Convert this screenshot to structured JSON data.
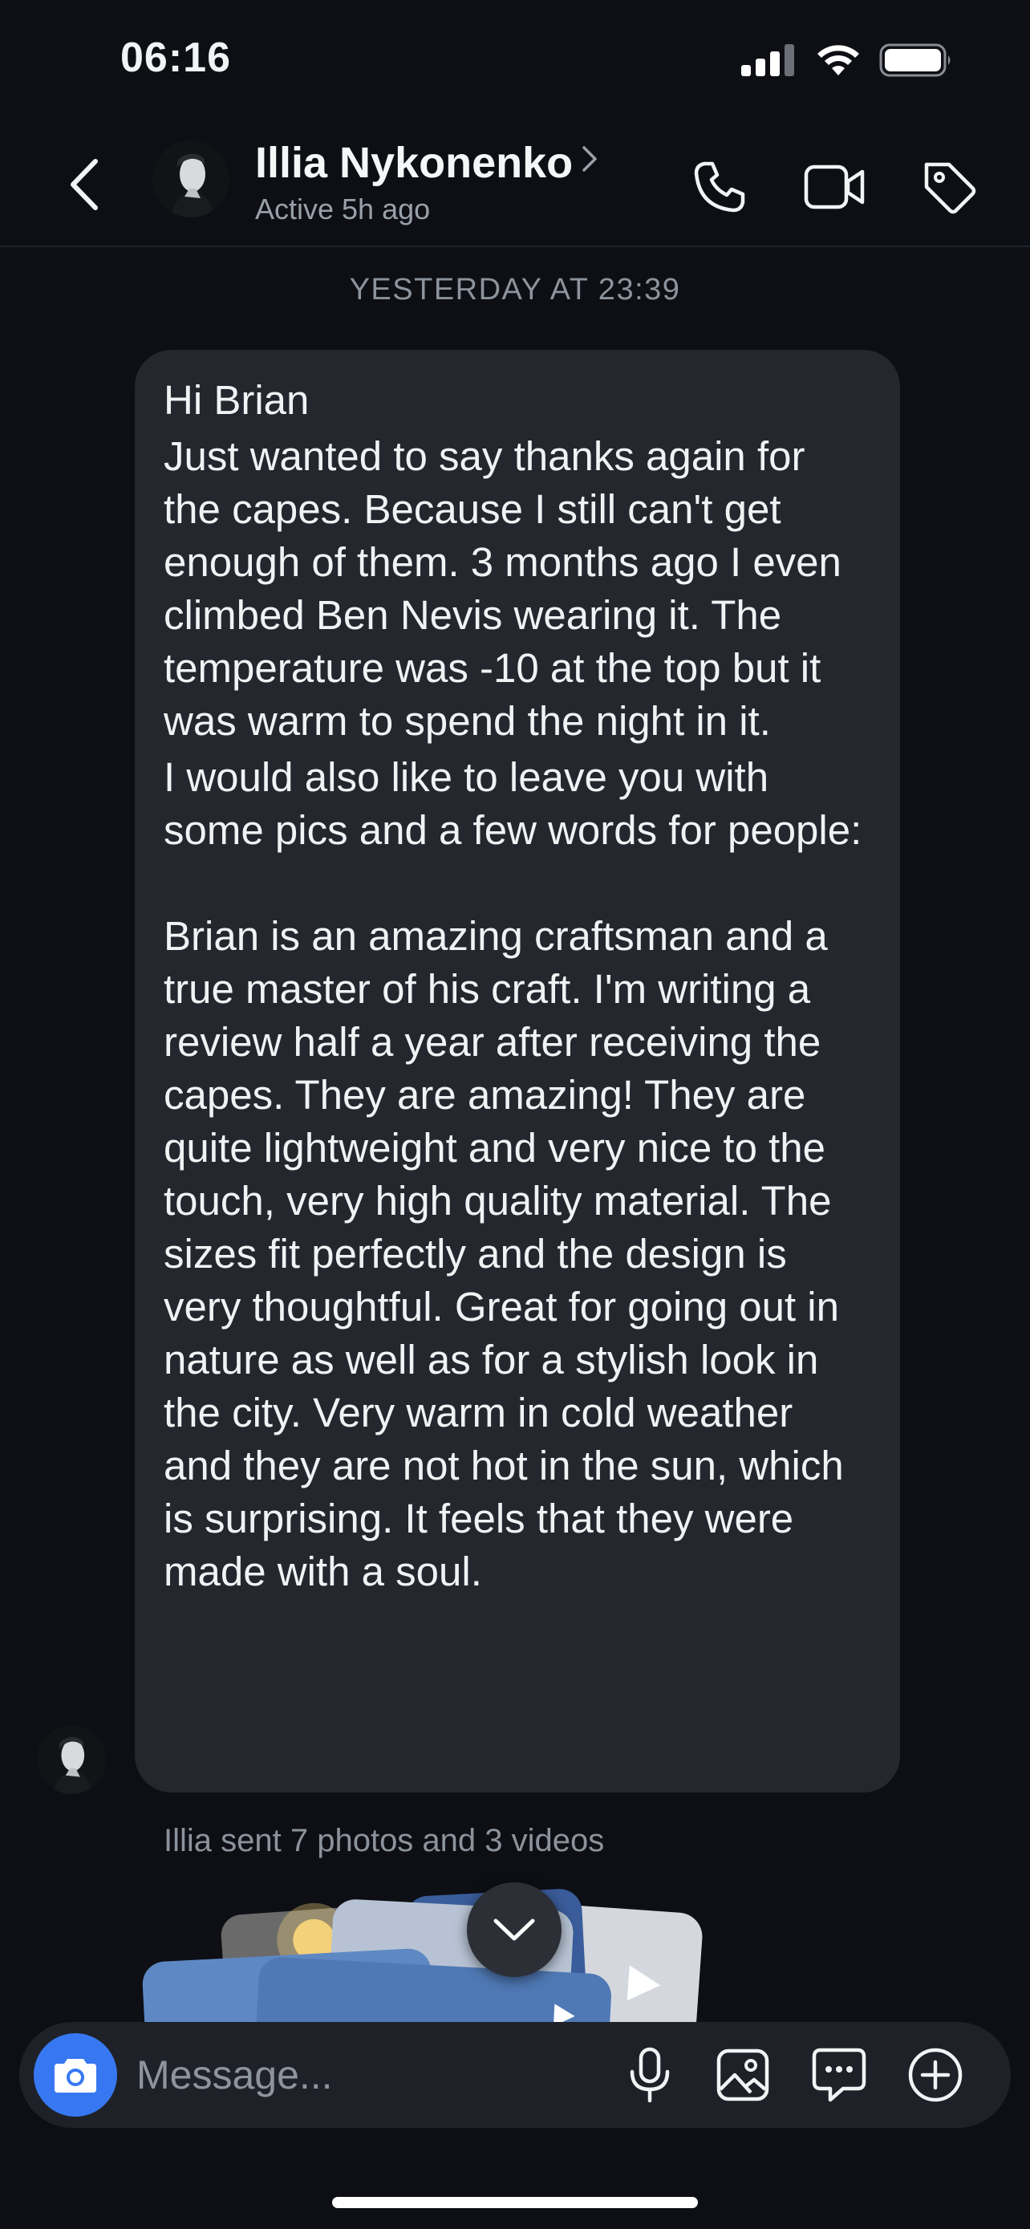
{
  "status_bar": {
    "time": "06:16",
    "icons": [
      "signal-icon",
      "wifi-icon",
      "battery-icon"
    ]
  },
  "header": {
    "contact_name": "Illia Nykonenko",
    "contact_status": "Active 5h ago",
    "actions": [
      "phone-icon",
      "video-call-icon",
      "tag-icon"
    ]
  },
  "conversation": {
    "date_separator": "YESTERDAY AT 23:39",
    "message": {
      "greeting": "Hi Brian",
      "paragraph1": "Just wanted to say thanks again for the capes. Because I still can't get enough of them. 3 months ago I even climbed Ben Nevis wearing it. The temperature was -10 at the top but it was warm to spend the night in it.",
      "paragraph2": "I would also like to leave you with some pics and a few words for people:",
      "paragraph3": "Brian is an amazing craftsman and a true master of his craft. I'm writing a review half a year after receiving the capes. They are amazing! They are quite lightweight and very nice to the touch, very high quality material. The sizes fit perfectly and the design is very thoughtful. Great for going out in nature as well as for a stylish look in the city. Very warm in cold weather and they are not hot in the sun, which is surprising. It feels that they were made with a soul."
    },
    "media_caption": "Illia sent 7 photos and 3 videos"
  },
  "composer": {
    "placeholder": "Message...",
    "icons": [
      "camera-icon",
      "microphone-icon",
      "gallery-icon",
      "sticker-icon",
      "plus-icon"
    ]
  },
  "colors": {
    "background": "#0d0f15",
    "bubble": "#25272e",
    "accent": "#3778f2",
    "muted_text": "#8d939c"
  }
}
